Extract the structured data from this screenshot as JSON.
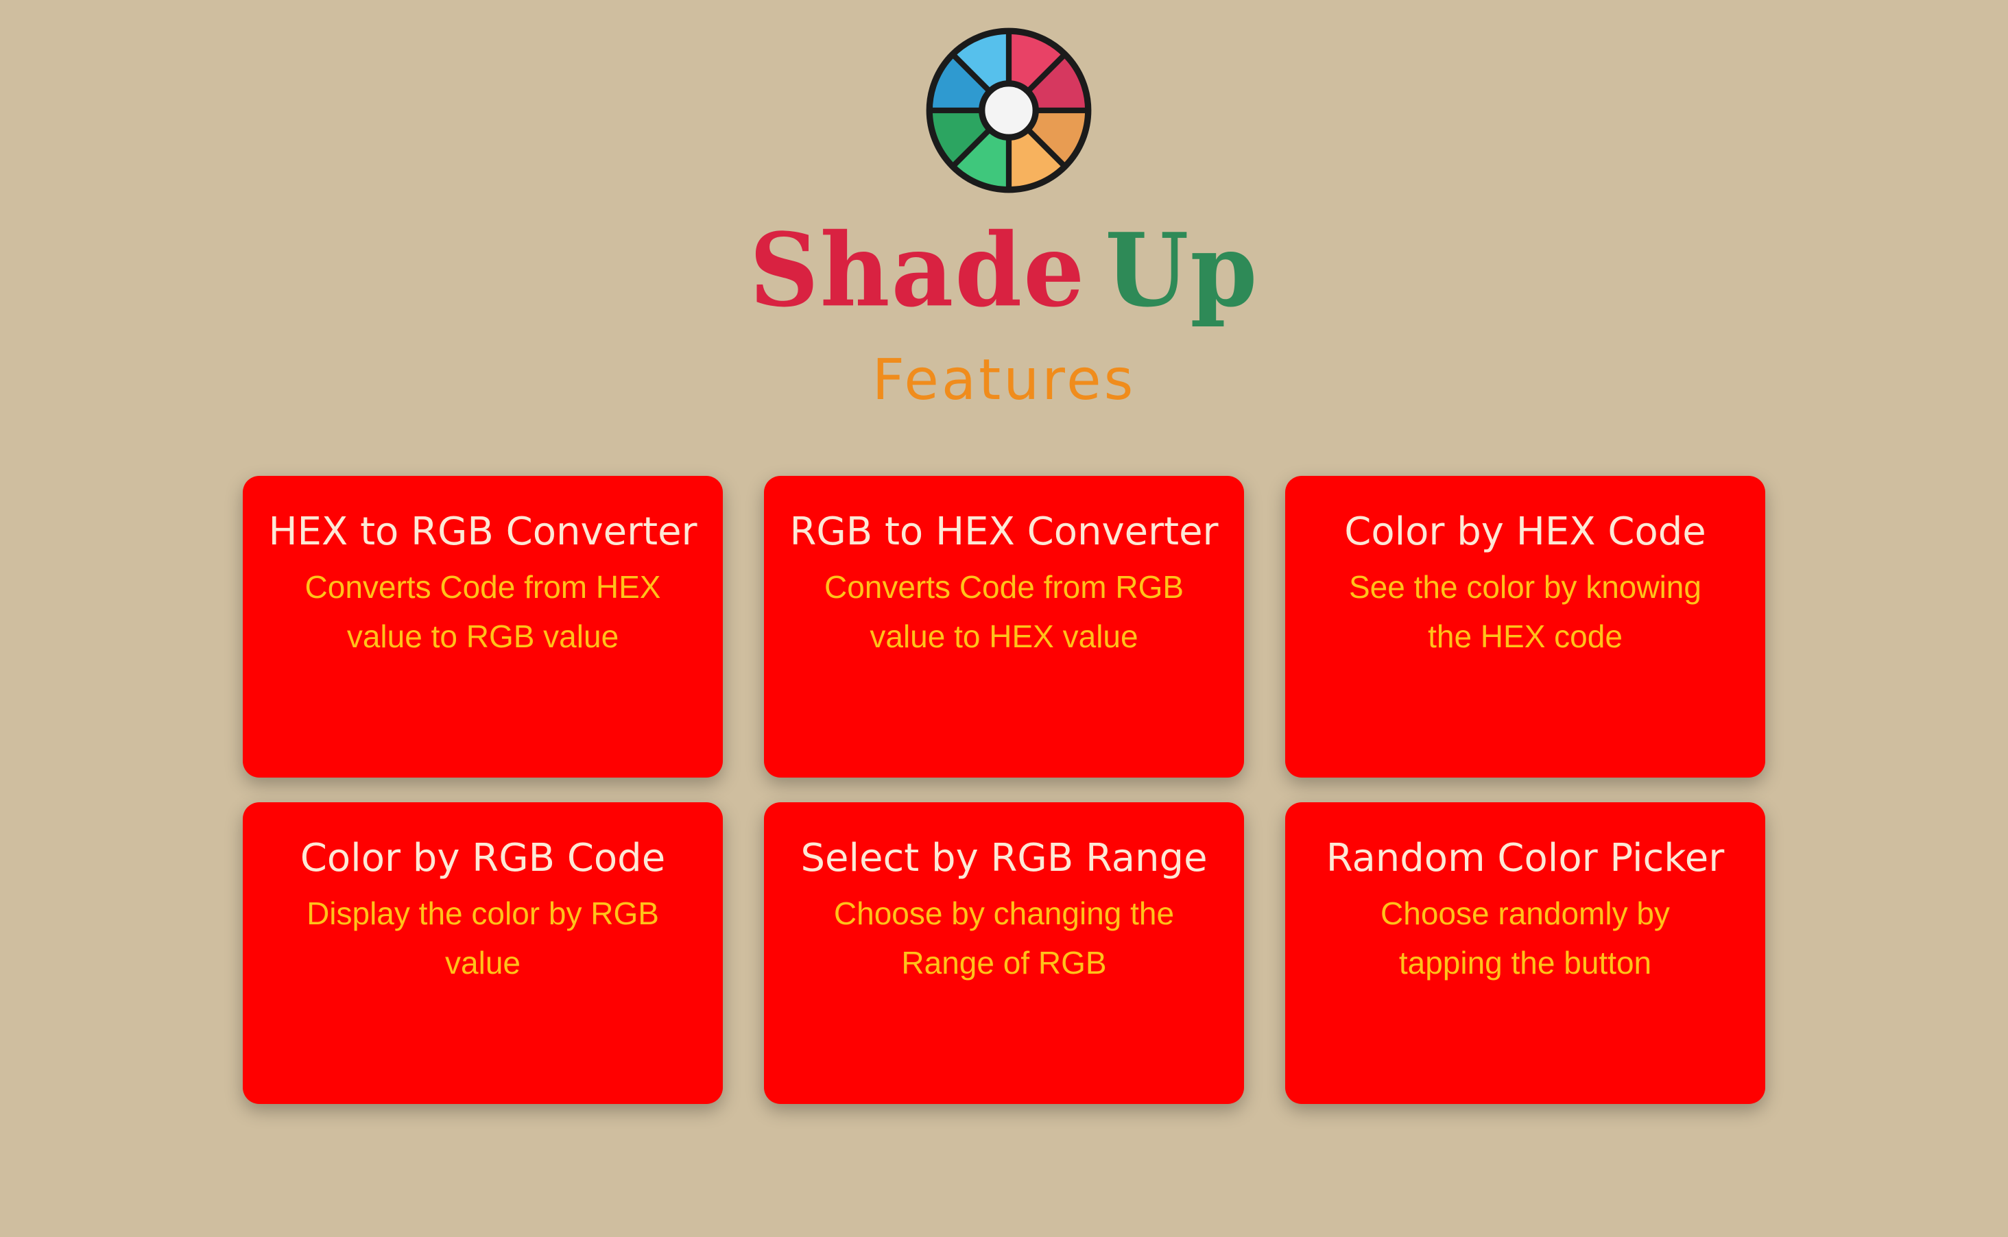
{
  "brand": {
    "logo_icon": "color-wheel-icon",
    "name_part1": "Shade",
    "name_part2": "Up",
    "colors": {
      "part1": "#d92241",
      "part2": "#2e8a57"
    }
  },
  "section": {
    "title": "Features",
    "title_color": "#f08c1c"
  },
  "theme": {
    "background": "#cfbe9f",
    "card_background": "#ff0000",
    "card_title_color": "#fde8d6",
    "card_desc_color": "#ffc21a"
  },
  "features": [
    {
      "title": "HEX to RGB Converter",
      "description": "Converts Code from HEX value to RGB value"
    },
    {
      "title": "RGB to HEX Converter",
      "description": "Converts Code from RGB value to HEX value"
    },
    {
      "title": "Color by HEX Code",
      "description": "See the color by knowing the HEX code"
    },
    {
      "title": "Color by RGB Code",
      "description": "Display the color by RGB value"
    },
    {
      "title": "Select by RGB Range",
      "description": "Choose by changing the Range of RGB"
    },
    {
      "title": "Random Color Picker",
      "description": "Choose randomly by tapping the button"
    }
  ]
}
